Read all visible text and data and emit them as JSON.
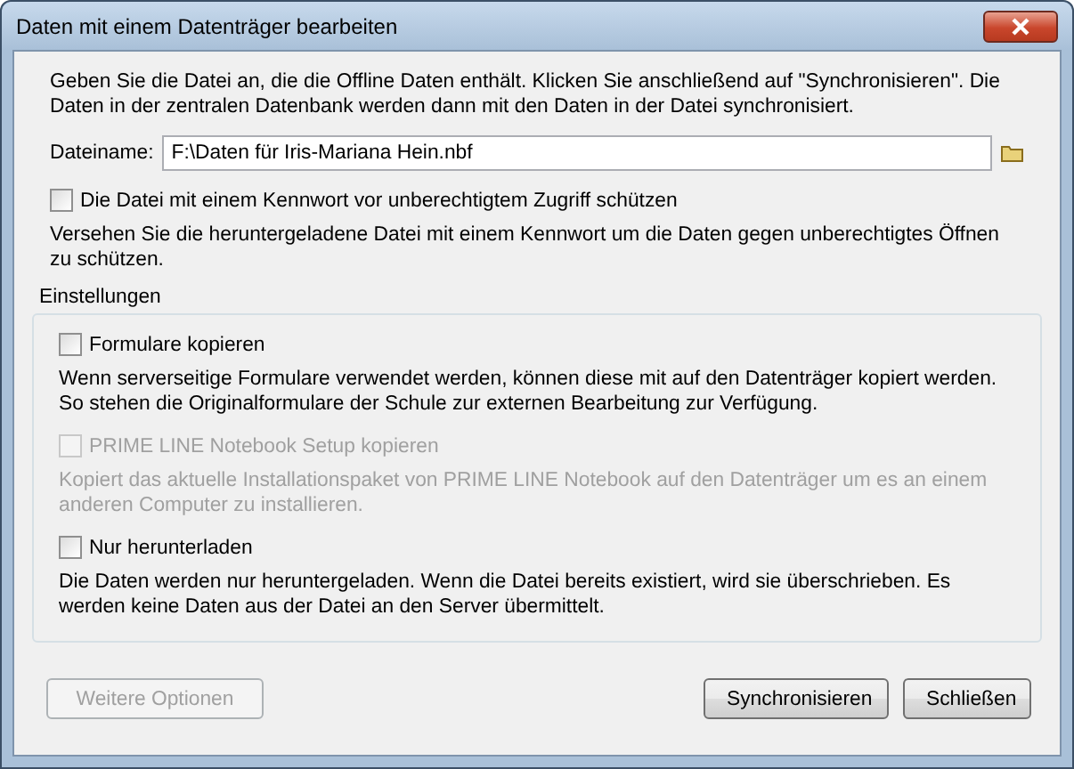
{
  "window": {
    "title": "Daten mit einem Datenträger bearbeiten"
  },
  "intro": "Geben Sie die Datei an, die die Offline Daten enthält. Klicken Sie anschließend auf \"Synchronisieren\". Die Daten in der zentralen Datenbank werden dann mit den Daten in der Datei synchronisiert.",
  "file": {
    "label": "Dateiname:",
    "value": "F:\\Daten für Iris-Mariana Hein.nbf"
  },
  "protect": {
    "label": "Die Datei mit einem Kennwort vor unberechtigtem Zugriff schützen",
    "checked": false,
    "disabled": false,
    "description": "Versehen Sie die heruntergeladene Datei mit einem Kennwort um die Daten gegen unberechtigtes Öffnen zu schützen."
  },
  "settings": {
    "title": "Einstellungen",
    "options": [
      {
        "label": "Formulare kopieren",
        "checked": false,
        "disabled": false,
        "description": "Wenn serverseitige Formulare verwendet werden, können diese mit auf den Datenträger kopiert werden. So stehen die Originalformulare der Schule zur externen Bearbeitung zur Verfügung."
      },
      {
        "label": "PRIME LINE Notebook Setup kopieren",
        "checked": false,
        "disabled": true,
        "description": "Kopiert das aktuelle Installationspaket von PRIME LINE Notebook auf den Datenträger um es an einem anderen Computer zu installieren."
      },
      {
        "label": "Nur herunterladen",
        "checked": false,
        "disabled": false,
        "description": "Die Daten werden nur heruntergeladen. Wenn die Datei bereits existiert, wird sie überschrieben. Es werden keine Daten aus der Datei an den Server übermittelt."
      }
    ]
  },
  "buttons": [
    {
      "label": "Weitere Optionen",
      "disabled": true,
      "kind": "extra"
    },
    {
      "label": "Synchronisieren",
      "disabled": false,
      "kind": "action"
    },
    {
      "label": "Schließen",
      "disabled": false,
      "kind": "action"
    }
  ]
}
